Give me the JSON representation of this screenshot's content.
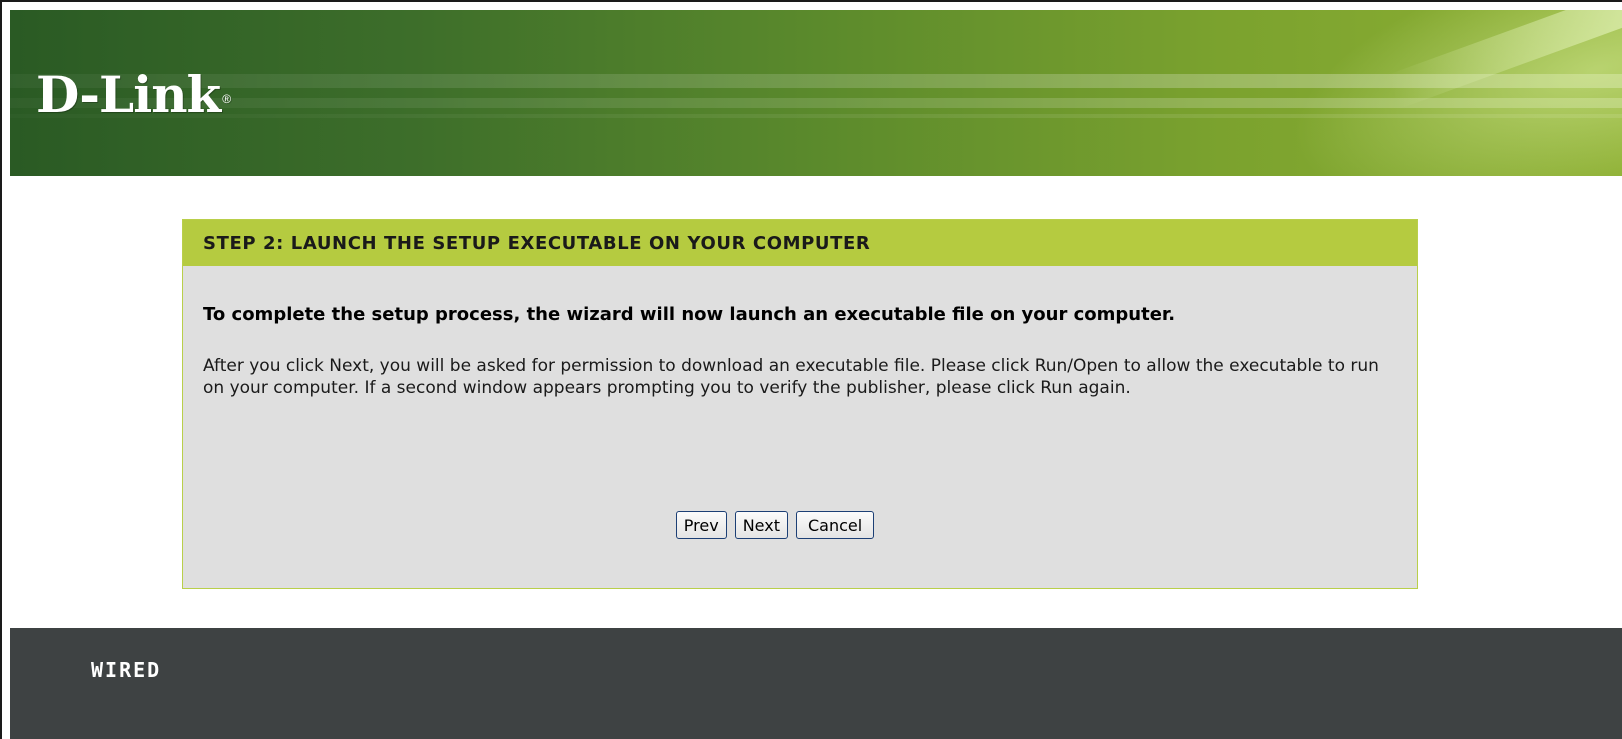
{
  "brand": {
    "logo_text": "D-Link",
    "registered_mark": "®"
  },
  "wizard": {
    "title": "STEP 2: LAUNCH THE SETUP EXECUTABLE ON YOUR COMPUTER",
    "lead": "To complete the setup process, the wizard will now launch an executable file on your computer.",
    "description": "After you click Next, you will be asked for permission to download an executable file. Please click Run/Open to allow the executable to run on your computer. If a second window appears prompting you to verify the publisher, please click Run again.",
    "buttons": {
      "prev": "Prev",
      "next": "Next",
      "cancel": "Cancel"
    }
  },
  "footer": {
    "label": "WIRED"
  },
  "colors": {
    "title_bar": "#b5cb40",
    "panel": "#dfdfdf",
    "footer": "#3e4243",
    "header_dark": "#2a5a24",
    "header_light": "#8eb034"
  }
}
